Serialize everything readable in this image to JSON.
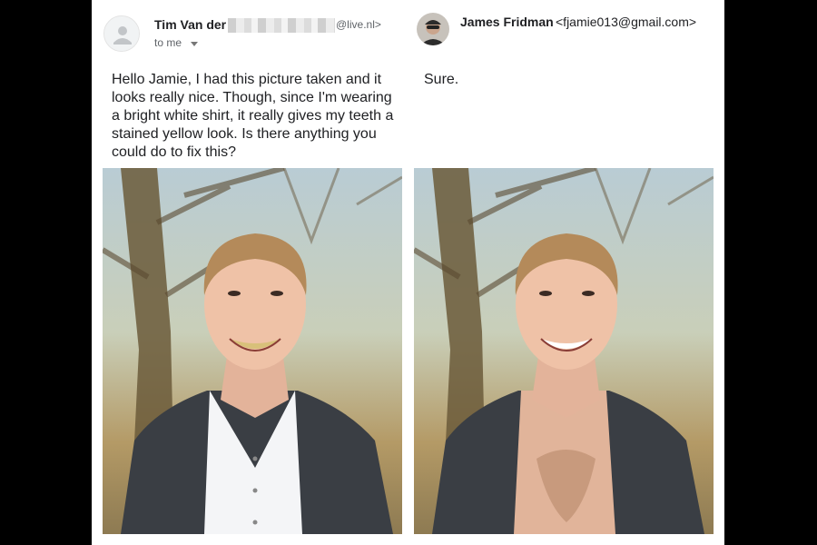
{
  "original_email": {
    "sender_name": "Tim Van der",
    "sender_domain": "@live.nl>",
    "recipient": "to me",
    "body": "Hello Jamie, I had this picture taken and it looks really nice. Though, since I'm wearing a bright white shirt, it really gives my teeth a stained yellow look. Is there anything you could do to fix this?",
    "icons": [
      "default-avatar-icon",
      "caret-down-icon"
    ]
  },
  "reply_email": {
    "sender_name": "James Fridman",
    "sender_email": "<fjamie013@gmail.com>",
    "body": "Sure."
  },
  "photos": {
    "before": "portrait-white-shirt",
    "after": "portrait-no-shirt"
  },
  "colors": {
    "background": "#000000",
    "page": "#ffffff",
    "text": "#202124",
    "muted": "#5f6368"
  }
}
